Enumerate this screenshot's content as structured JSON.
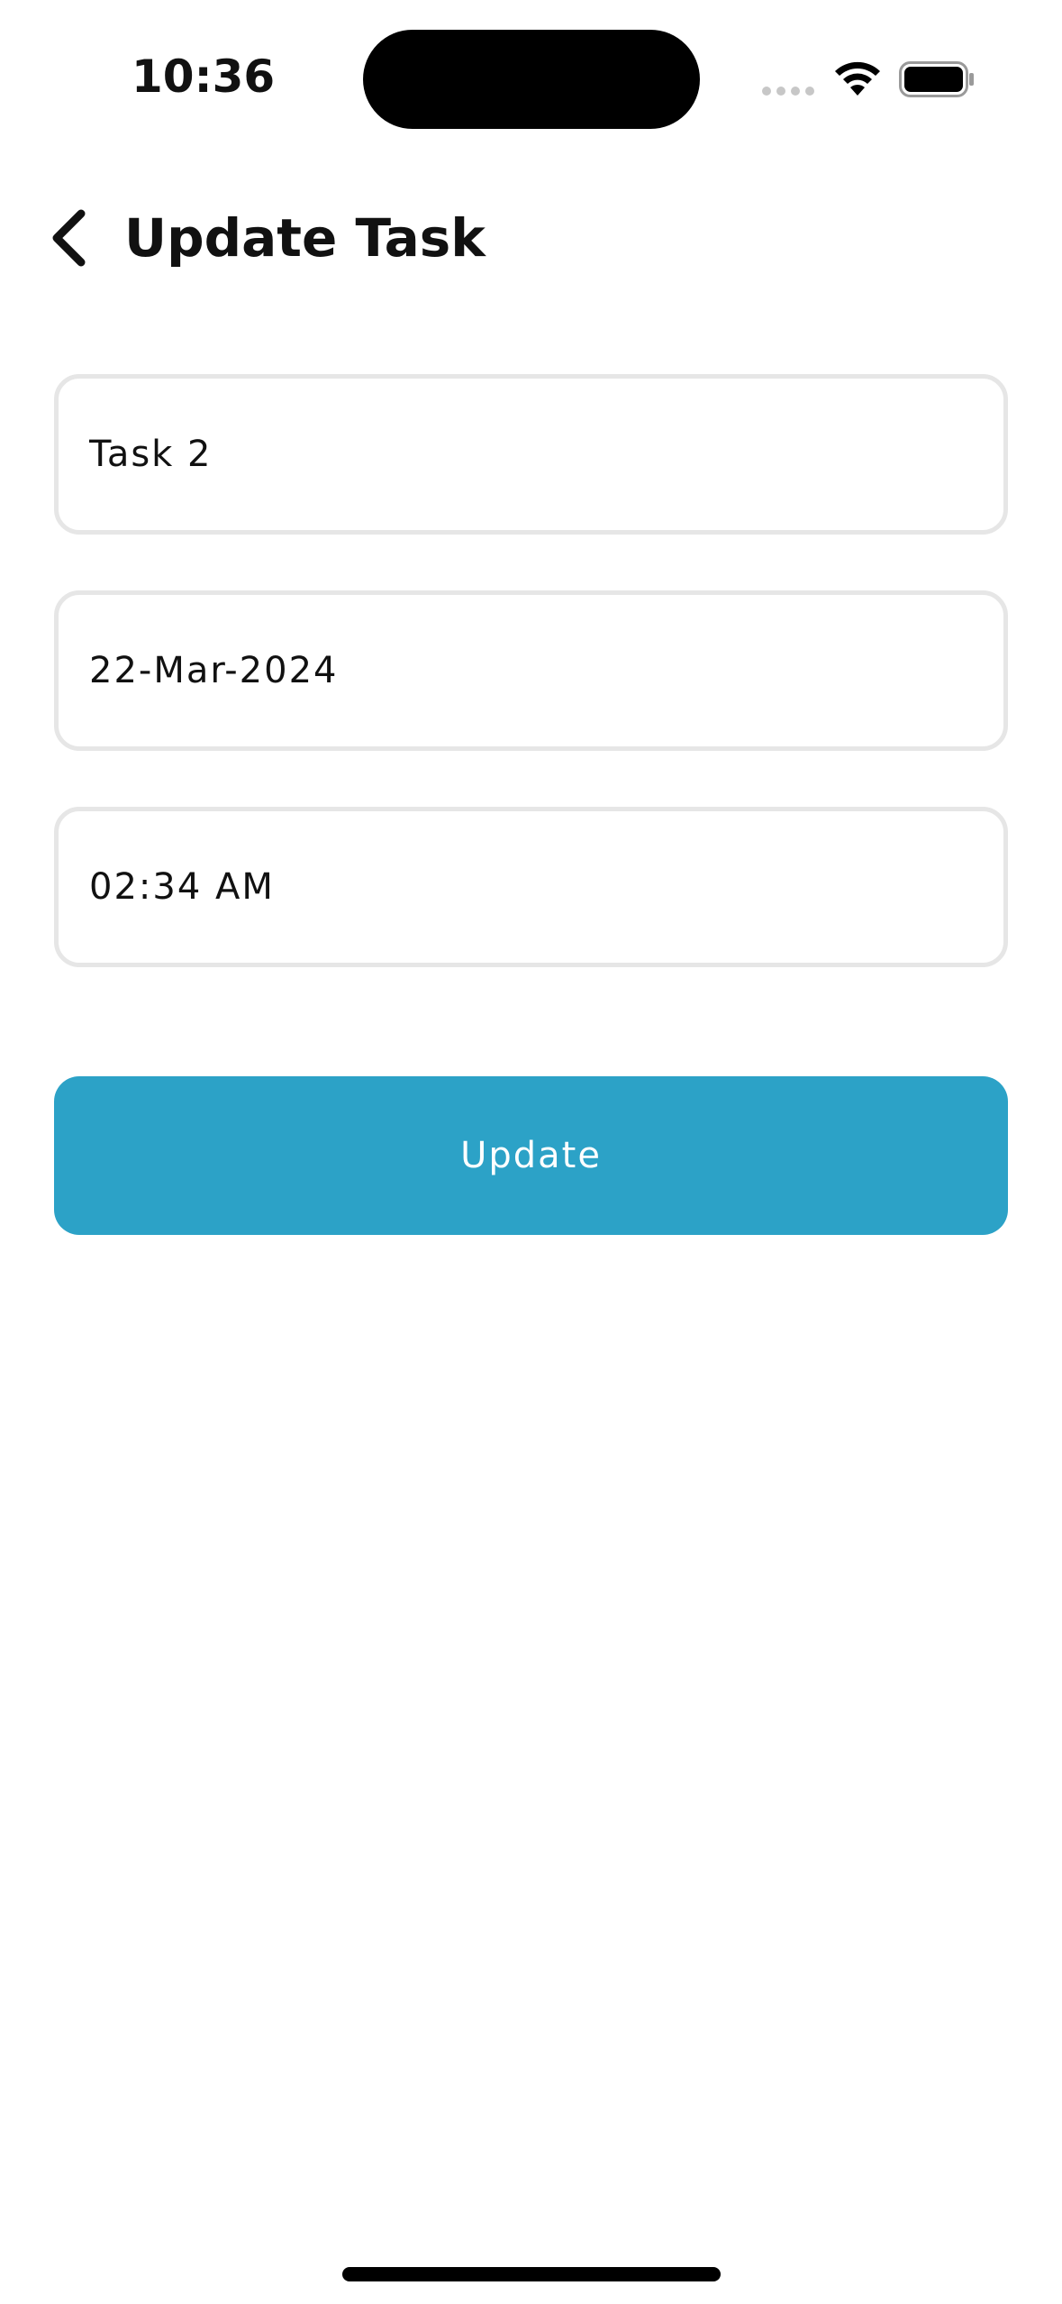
{
  "status_bar": {
    "time": "10:36",
    "icons": [
      "signal-dots-icon",
      "wifi-icon",
      "battery-icon"
    ]
  },
  "header": {
    "back_icon": "chevron-left-icon",
    "title": "Update Task"
  },
  "form": {
    "task_name": {
      "value": "Task 2"
    },
    "date": {
      "value": "22-Mar-2024"
    },
    "time": {
      "value": "02:34 AM"
    }
  },
  "actions": {
    "update_label": "Update"
  },
  "colors": {
    "accent": "#2ca2c7",
    "field_border": "#e6e6e6",
    "text": "#111111",
    "background": "#ffffff"
  }
}
